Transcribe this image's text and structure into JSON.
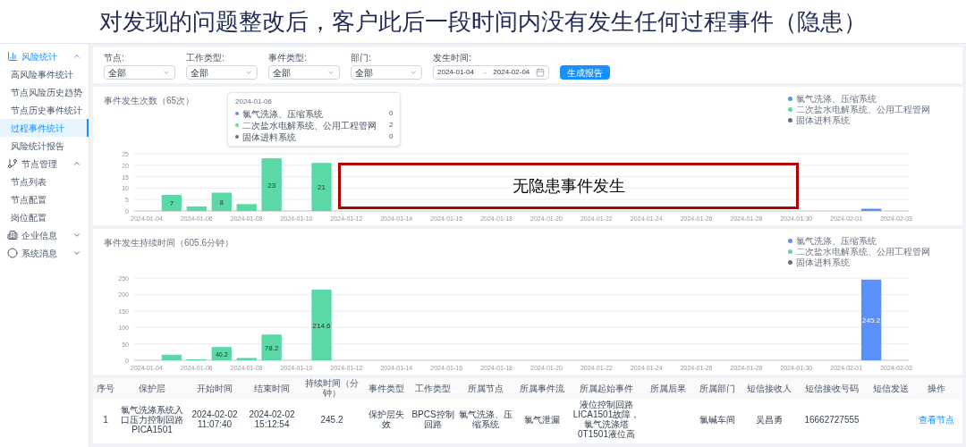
{
  "slide_title": "对发现的问题整改后，客户此后一段时间内没有发生任何过程事件（隐患）",
  "annotation": "无隐患事件发生",
  "sidebar": {
    "groups": [
      {
        "label": "风险统计",
        "expanded": true,
        "children": [
          {
            "label": "高风险事件统计",
            "selected": false
          },
          {
            "label": "节点风险历史趋势",
            "selected": false
          },
          {
            "label": "节点历史事件统计",
            "selected": false
          },
          {
            "label": "过程事件统计",
            "selected": true
          },
          {
            "label": "风险统计报告",
            "selected": false
          }
        ]
      },
      {
        "label": "节点管理",
        "expanded": true,
        "children": [
          {
            "label": "节点列表",
            "selected": false
          },
          {
            "label": "节点配置",
            "selected": false
          },
          {
            "label": "岗位配置",
            "selected": false
          }
        ]
      },
      {
        "label": "企业信息",
        "expanded": false
      },
      {
        "label": "系统消息",
        "expanded": false
      }
    ]
  },
  "filters": [
    {
      "kind": "select",
      "label": "节点:",
      "value": "全部"
    },
    {
      "kind": "select",
      "label": "工作类型:",
      "value": "全部"
    },
    {
      "kind": "select",
      "label": "事件类型:",
      "value": "全部"
    },
    {
      "kind": "select",
      "label": "部门:",
      "value": "全部"
    },
    {
      "kind": "daterange",
      "label": "发生时间:",
      "start": "2024-01-04",
      "separator": "→",
      "end": "2024-02-04"
    }
  ],
  "report_button": "生成报告",
  "charts": [
    {
      "chart_data": {
        "type": "bar",
        "title": "事件发生次数（65次）",
        "stacked": true,
        "grid": true,
        "categories": [
          "2024-01-04",
          null,
          "2024-01-06",
          null,
          "2024-01-08",
          null,
          "2024-01-10",
          null,
          "2024-01-12",
          null,
          "2024-01-14",
          null,
          "2024-01-16",
          null,
          "2024-01-18",
          null,
          "2024-01-20",
          null,
          "2024-01-22",
          null,
          "2024-01-24",
          null,
          "2024-01-26",
          null,
          "2024-01-28",
          null,
          "2024-01-30",
          null,
          "2024-02-01",
          null,
          "2024-02-03"
        ],
        "series": [
          {
            "name": "氯气洗涤、压缩系统",
            "color": "#5b8ff9",
            "values": [
              null,
              null,
              null,
              null,
              null,
              null,
              null,
              null,
              null,
              null,
              null,
              null,
              null,
              null,
              null,
              null,
              null,
              null,
              null,
              null,
              null,
              null,
              null,
              null,
              null,
              null,
              null,
              null,
              null,
              1,
              null
            ]
          },
          {
            "name": "二次盐水电解系统、公用工程管网",
            "color": "#5ad8a6",
            "values": [
              null,
              7,
              2,
              8,
              3,
              23,
              null,
              21,
              null,
              null,
              null,
              null,
              null,
              null,
              null,
              null,
              null,
              null,
              null,
              null,
              null,
              null,
              null,
              null,
              null,
              null,
              null,
              null,
              null,
              null,
              null
            ],
            "value_labels": [
              null,
              "7",
              null,
              "8",
              null,
              "23",
              null,
              "21",
              null,
              null,
              null,
              null,
              null,
              null,
              null,
              null,
              null,
              null,
              null,
              null,
              null,
              null,
              null,
              null,
              null,
              null,
              null,
              null,
              null,
              null,
              null
            ]
          },
          {
            "name": "固体进料系统",
            "color": "#5d7092",
            "values": [
              null,
              null,
              null,
              null,
              null,
              null,
              null,
              null,
              null,
              null,
              null,
              null,
              null,
              null,
              null,
              null,
              null,
              null,
              null,
              null,
              null,
              null,
              null,
              null,
              null,
              null,
              null,
              null,
              null,
              null,
              null
            ]
          }
        ],
        "ylim": [
          0,
          25
        ],
        "yticks": [
          0,
          5,
          10,
          15,
          20,
          25
        ]
      },
      "tooltip": {
        "date": "2024-01-06",
        "rows": [
          {
            "name": "氯气洗涤、压缩系统",
            "color": "#5b8ff9",
            "value": "0"
          },
          {
            "name": "二次盐水电解系统、公用工程管网",
            "color": "#5ad8a6",
            "value": "2"
          },
          {
            "name": "固体进料系统",
            "color": "#5d7092",
            "value": "0"
          }
        ]
      }
    },
    {
      "chart_data": {
        "type": "bar",
        "title": "事件发生持续时间（605.6分钟）",
        "stacked": true,
        "grid": true,
        "categories": [
          "2024-01-04",
          null,
          "2024-01-06",
          null,
          "2024-01-08",
          null,
          "2024-01-10",
          null,
          "2024-01-12",
          null,
          "2024-01-14",
          null,
          "2024-01-16",
          null,
          "2024-01-18",
          null,
          "2024-01-20",
          null,
          "2024-01-22",
          null,
          "2024-01-24",
          null,
          "2024-01-26",
          null,
          "2024-01-28",
          null,
          "2024-01-30",
          null,
          "2024-02-01",
          null,
          "2024-02-03"
        ],
        "series": [
          {
            "name": "氯气洗涤、压缩系统",
            "color": "#5b8ff9",
            "values": [
              null,
              null,
              null,
              null,
              null,
              null,
              null,
              null,
              null,
              null,
              null,
              null,
              null,
              null,
              null,
              null,
              null,
              null,
              null,
              null,
              null,
              null,
              null,
              null,
              null,
              null,
              null,
              null,
              null,
              245.2,
              null
            ],
            "value_labels": [
              null,
              null,
              null,
              null,
              null,
              null,
              null,
              null,
              null,
              null,
              null,
              null,
              null,
              null,
              null,
              null,
              null,
              null,
              null,
              null,
              null,
              null,
              null,
              null,
              null,
              null,
              null,
              null,
              null,
              "245.2",
              null
            ]
          },
          {
            "name": "二次盐水电解系统、公用工程管网",
            "color": "#5ad8a6",
            "values": [
              null,
              17,
              3,
              40.2,
              7,
              78.2,
              null,
              214.6,
              null,
              null,
              null,
              null,
              null,
              null,
              null,
              null,
              null,
              null,
              null,
              null,
              null,
              null,
              null,
              null,
              null,
              null,
              null,
              null,
              null,
              null,
              null
            ],
            "value_labels": [
              null,
              null,
              null,
              "40.2",
              null,
              "78.2",
              null,
              "214.6",
              null,
              null,
              null,
              null,
              null,
              null,
              null,
              null,
              null,
              null,
              null,
              null,
              null,
              null,
              null,
              null,
              null,
              null,
              null,
              null,
              null,
              null,
              null
            ]
          },
          {
            "name": "固体进料系统",
            "color": "#5d7092",
            "values": [
              null,
              null,
              null,
              null,
              null,
              null,
              null,
              null,
              null,
              null,
              null,
              null,
              null,
              null,
              null,
              null,
              null,
              null,
              null,
              null,
              null,
              null,
              null,
              null,
              null,
              null,
              null,
              null,
              null,
              null,
              null
            ]
          }
        ],
        "ylim": [
          0,
          250
        ],
        "yticks": [
          0,
          50,
          100,
          150,
          200,
          250
        ]
      }
    }
  ],
  "table": {
    "columns": [
      "序号",
      "保护层",
      "开始时间",
      "结束时间",
      "持续时间（分钟）",
      "事件类型",
      "工作类型",
      "所属节点",
      "所属事件流",
      "所属起始事件",
      "所属后果",
      "所属部门",
      "短信接收人",
      "短信接收号码",
      "短信发送",
      "操作"
    ],
    "rows": [
      {
        "cells": [
          "1",
          "氯气洗涤系统入口压力控制回路PICA1501",
          "2024-02-02 11:07:40",
          "2024-02-02 15:12:54",
          "245.2",
          "保护层失效",
          "BPCS控制回路",
          "氯气洗涤、压缩系统",
          "氯气泄漏",
          "液位控制回路LICA1501故障，氯气洗涤塔0T1501液位高",
          "",
          "氯碱车间",
          "吴昌勇",
          "16662727555",
          ""
        ],
        "action": "查看节点"
      }
    ]
  }
}
